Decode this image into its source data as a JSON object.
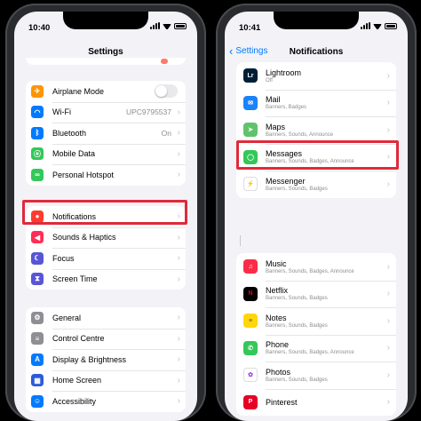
{
  "left_phone": {
    "status_time": "10:40",
    "title": "Settings",
    "groups": [
      [
        {
          "label": "Airplane Mode",
          "icon": "airplane-icon",
          "color": "#ff9500",
          "toggle": true
        },
        {
          "label": "Wi-Fi",
          "icon": "wifi-icon",
          "color": "#007aff",
          "value": "UPC9795537"
        },
        {
          "label": "Bluetooth",
          "icon": "bluetooth-icon",
          "color": "#007aff",
          "value": "On"
        },
        {
          "label": "Mobile Data",
          "icon": "antenna-icon",
          "color": "#34c759"
        },
        {
          "label": "Personal Hotspot",
          "icon": "link-icon",
          "color": "#34c759"
        }
      ],
      [
        {
          "label": "Notifications",
          "icon": "bell-icon",
          "color": "#ff3b30"
        },
        {
          "label": "Sounds & Haptics",
          "icon": "speaker-icon",
          "color": "#ff2d55"
        },
        {
          "label": "Focus",
          "icon": "moon-icon",
          "color": "#5856d6"
        },
        {
          "label": "Screen Time",
          "icon": "hourglass-icon",
          "color": "#5856d6"
        }
      ],
      [
        {
          "label": "General",
          "icon": "gear-icon",
          "color": "#8e8e93"
        },
        {
          "label": "Control Centre",
          "icon": "sliders-icon",
          "color": "#8e8e93"
        },
        {
          "label": "Display & Brightness",
          "icon": "text-size-icon",
          "color": "#007aff"
        },
        {
          "label": "Home Screen",
          "icon": "grid-icon",
          "color": "#2c5bd6"
        },
        {
          "label": "Accessibility",
          "icon": "accessibility-icon",
          "color": "#007aff"
        }
      ]
    ]
  },
  "right_phone": {
    "status_time": "10:41",
    "back_label": "Settings",
    "title": "Notifications",
    "apps_top": [
      {
        "name": "Lightroom",
        "subtitle": "Off",
        "icon": "lightroom-icon",
        "color": "#001e36",
        "glyph": "Lr"
      },
      {
        "name": "Mail",
        "subtitle": "Banners, Badges",
        "icon": "mail-icon",
        "color": "#1a82fb",
        "glyph": "✉"
      },
      {
        "name": "Maps",
        "subtitle": "Banners, Sounds, Announce",
        "icon": "maps-icon",
        "color": "#5fc36c",
        "glyph": "➤"
      },
      {
        "name": "Messages",
        "subtitle": "Banners, Sounds, Badges, Announce",
        "icon": "messages-icon",
        "color": "#34c759",
        "glyph": "◯"
      },
      {
        "name": "Messenger",
        "subtitle": "Banners, Sounds, Badges",
        "icon": "messenger-icon",
        "color": "#ffffff",
        "glyph": "⚡"
      }
    ],
    "apps_bottom": [
      {
        "name": "Music",
        "subtitle": "Banners, Sounds, Badges, Announce",
        "icon": "music-icon",
        "color": "#fa2d48",
        "glyph": "♫"
      },
      {
        "name": "Netflix",
        "subtitle": "Banners, Sounds, Badges",
        "icon": "netflix-icon",
        "color": "#000000",
        "glyph": "N"
      },
      {
        "name": "Notes",
        "subtitle": "Banners, Sounds, Badges",
        "icon": "notes-icon",
        "color": "#ffd60a",
        "glyph": "≡"
      },
      {
        "name": "Phone",
        "subtitle": "Banners, Sounds, Badges, Announce",
        "icon": "phone-icon",
        "color": "#34c759",
        "glyph": "✆"
      },
      {
        "name": "Photos",
        "subtitle": "Banners, Sounds, Badges",
        "icon": "photos-icon",
        "color": "#ffffff",
        "glyph": "✿"
      },
      {
        "name": "Pinterest",
        "subtitle": "",
        "icon": "pinterest-icon",
        "color": "#e60023",
        "glyph": "P"
      }
    ]
  },
  "colors": {
    "highlight": "#e02a3a",
    "accent": "#007aff"
  }
}
